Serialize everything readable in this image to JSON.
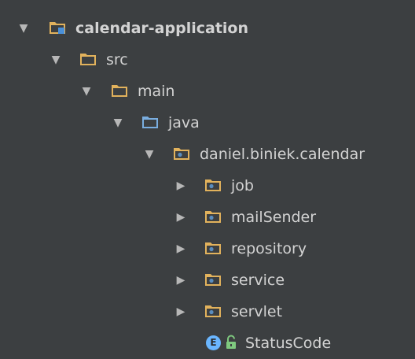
{
  "tree": {
    "items": [
      {
        "label": "calendar-application",
        "level": 0,
        "expanded": true,
        "type": "module"
      },
      {
        "label": "src",
        "level": 1,
        "expanded": true,
        "type": "folder"
      },
      {
        "label": "main",
        "level": 2,
        "expanded": true,
        "type": "folder"
      },
      {
        "label": "java",
        "level": 3,
        "expanded": true,
        "type": "source-root"
      },
      {
        "label": "daniel.biniek.calendar",
        "level": 4,
        "expanded": true,
        "type": "package"
      },
      {
        "label": "job",
        "level": 5,
        "expanded": false,
        "type": "package"
      },
      {
        "label": "mailSender",
        "level": 5,
        "expanded": false,
        "type": "package"
      },
      {
        "label": "repository",
        "level": 5,
        "expanded": false,
        "type": "package"
      },
      {
        "label": "service",
        "level": 5,
        "expanded": false,
        "type": "package"
      },
      {
        "label": "servlet",
        "level": 5,
        "expanded": false,
        "type": "package"
      },
      {
        "label": "StatusCode",
        "level": 5,
        "type": "enum"
      }
    ],
    "enum_badge": "E"
  },
  "colors": {
    "background": "#3c3f41",
    "text": "#d3d3d3",
    "folder": "#e2b25c",
    "source_root": "#7aaee0",
    "package_dot": "#5a8dbf",
    "enum_badge": "#6ab6ff",
    "lock": "#7fc97f"
  },
  "icons": {
    "expanded": "triangle-down",
    "collapsed": "triangle-right",
    "module": "module-folder-icon",
    "folder": "folder-icon",
    "source-root": "source-folder-icon",
    "package": "package-icon",
    "enum": "enum-icon"
  }
}
